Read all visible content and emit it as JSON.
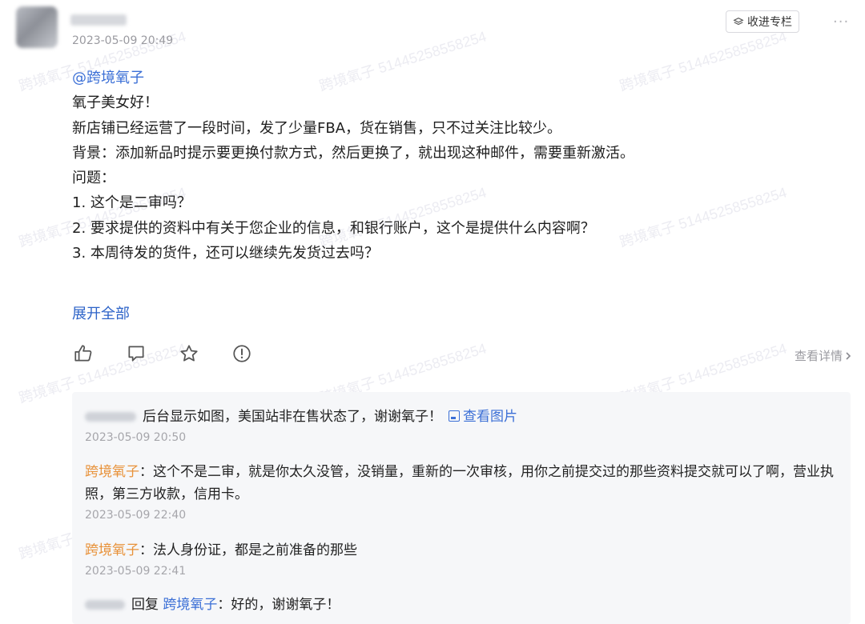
{
  "post": {
    "timestamp": "2023-05-09 20:49",
    "collect_label": "收进专栏",
    "more_label": "···",
    "mention": "@跨境氧子",
    "lines": [
      "氧子美女好！",
      "新店铺已经运营了一段时间，发了少量FBA，货在销售，只不过关注比较少。",
      "背景：添加新品时提示要更换付款方式，然后更换了，就出现这种邮件，需要重新激活。",
      "问题：",
      "1. 这个是二审吗？",
      "2. 要求提供的资料中有关于您企业的信息，和银行账户，这个是提供什么内容啊？",
      "3. 本周待发的货件，还可以继续先发货过去吗？"
    ],
    "expand_label": "展开全部",
    "detail_label": "查看详情",
    "watermark": "跨境氧子 51445258558254",
    "actions": {
      "like_icon": "thumbs-up-icon",
      "comment_icon": "comment-icon",
      "star_icon": "star-icon",
      "report_icon": "alert-icon"
    }
  },
  "comments": [
    {
      "text": "后台显示如图，美国站非在售状态了，谢谢氧子！",
      "view_image": "查看图片",
      "time": "2023-05-09 20:50"
    },
    {
      "author": "跨境氧子",
      "sep": "：",
      "text": "这个不是二审，就是你太久没管，没销量，重新的一次审核，用你之前提交过的那些资料提交就可以了啊，营业执照，第三方收款，信用卡。",
      "time": "2023-05-09 22:40"
    },
    {
      "author": "跨境氧子",
      "sep": "：",
      "text": "法人身份证，都是之前准备的那些",
      "time": "2023-05-09 22:41"
    },
    {
      "reply_word": "回复",
      "reply_to": "跨境氧子",
      "sep": "：",
      "text": "好的，谢谢氧子！"
    }
  ],
  "colors": {
    "link": "#3b6fd6",
    "author": "#e8923a",
    "muted": "#9a9aa0",
    "comment_bg": "#f6f7f9"
  }
}
